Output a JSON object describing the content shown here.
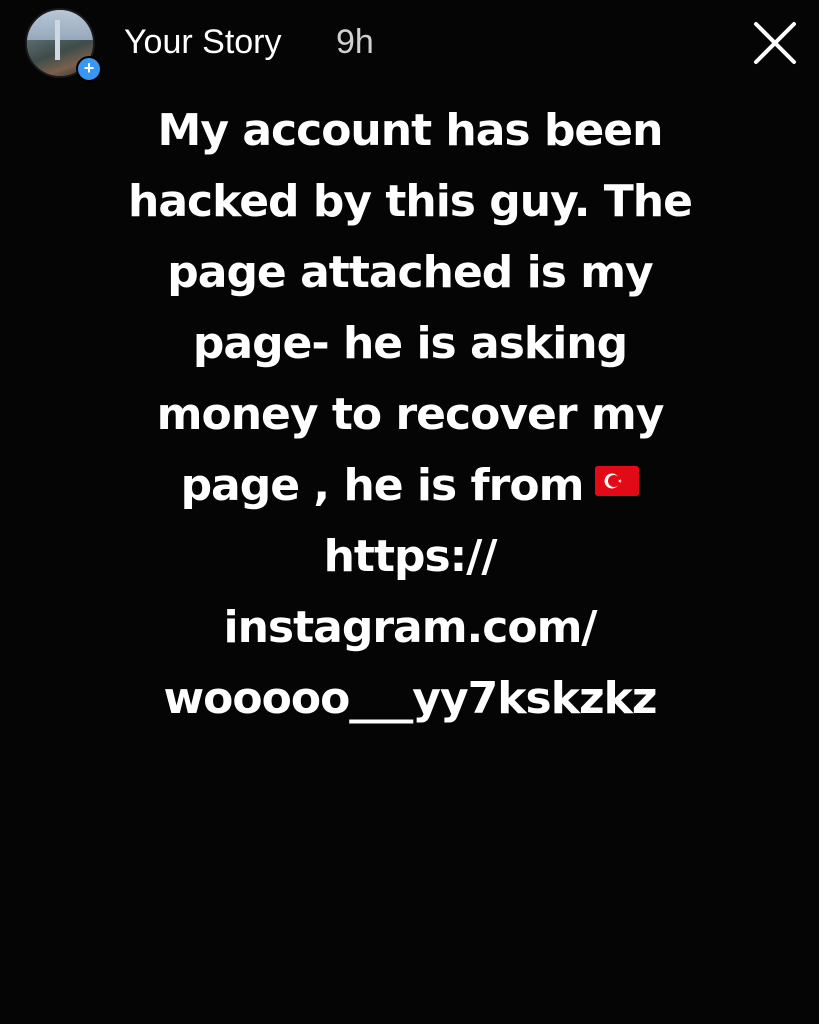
{
  "header": {
    "title": "Your Story",
    "time": "9h",
    "add_badge": "+",
    "close_icon": "close-icon",
    "avatar_icon": "avatar-photo"
  },
  "story": {
    "lines": [
      "My account has been",
      "hacked by this guy. The",
      "page attached is my",
      "page- he is asking",
      "money to recover my",
      "page , he is from",
      "https://",
      "instagram.com/",
      "wooooo___yy7kskzkz"
    ],
    "flag_icon": "turkey-flag-icon",
    "text_color": "#ffffff",
    "background_color": "#050505"
  },
  "colors": {
    "badge": "#3897f0",
    "flag_red": "#e30a17"
  }
}
